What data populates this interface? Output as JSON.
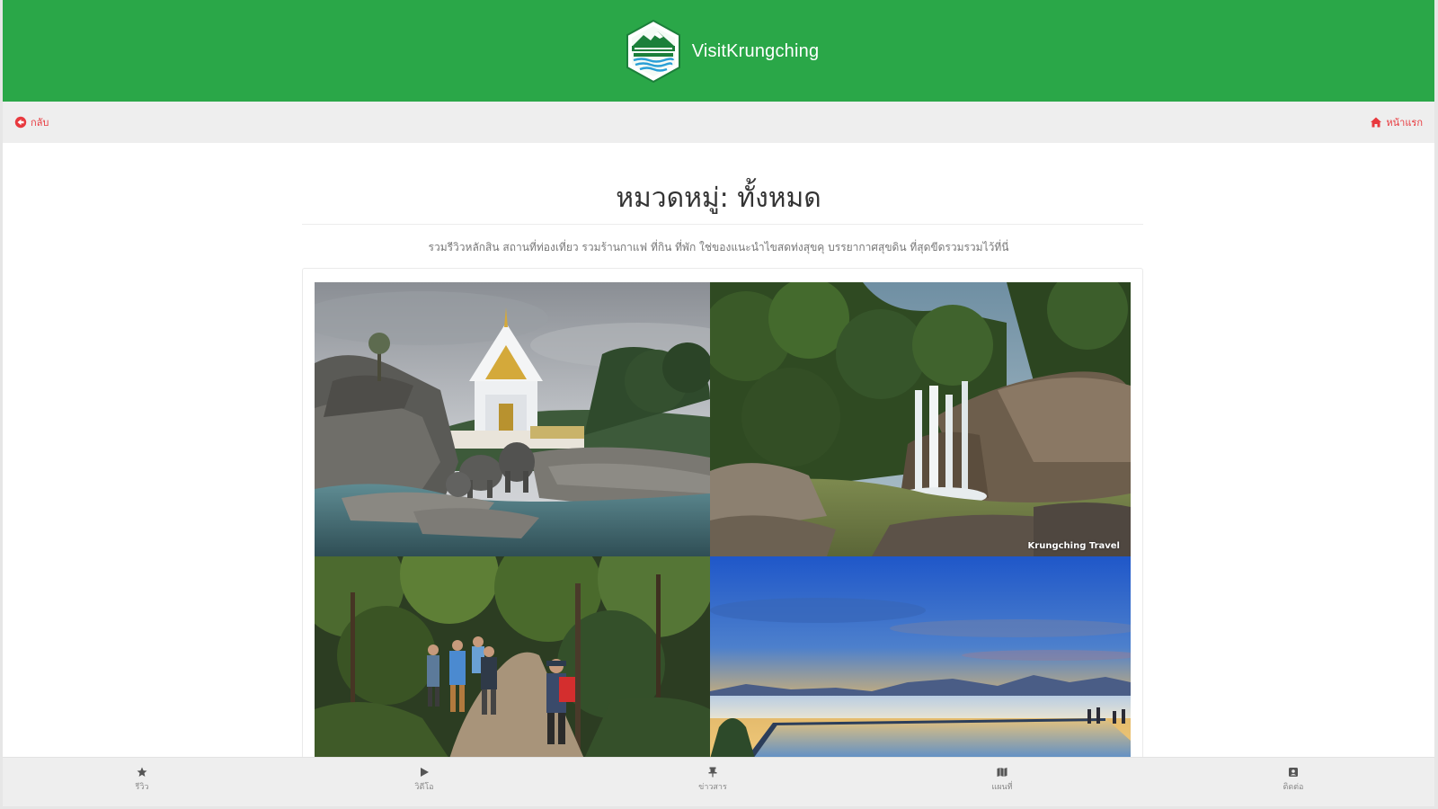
{
  "header": {
    "brand_name": "VisitKrungching",
    "logo_icon": "mountain-waterfall-emblem-icon",
    "background_color": "#2aa748"
  },
  "subnav": {
    "back_label": "กลับ",
    "back_icon": "circle-arrow-left-icon",
    "home_label": "หน้าแรก",
    "home_icon": "home-icon",
    "link_color": "#e8393e"
  },
  "main": {
    "title": "หมวดหมู่: ทั้งหมด",
    "description": "รวมรีวิวหลักสิน สถานที่ท่องเที่ยว รวมร้านกาแฟ ที่กิน ที่พัก ใช่ของแนะนำไขสดท่งสุขคุ บรรยากาศสุขดิน ที่สุดขีดรวมรวมไว้ที่นี่",
    "gallery": [
      {
        "name": "white-temple-elephant-statues-photo"
      },
      {
        "name": "forest-waterfall-photo",
        "watermark": "Krungching Travel"
      },
      {
        "name": "jungle-trekking-group-photo"
      },
      {
        "name": "sea-of-mist-sunrise-photo"
      }
    ]
  },
  "bottom_nav": {
    "items": [
      {
        "label": "รีวิว",
        "icon": "star-icon"
      },
      {
        "label": "วิดีโอ",
        "icon": "play-icon"
      },
      {
        "label": "ข่าวสาร",
        "icon": "pin-icon"
      },
      {
        "label": "แผนที่",
        "icon": "map-icon"
      },
      {
        "label": "ติดต่อ",
        "icon": "contact-icon"
      }
    ]
  }
}
